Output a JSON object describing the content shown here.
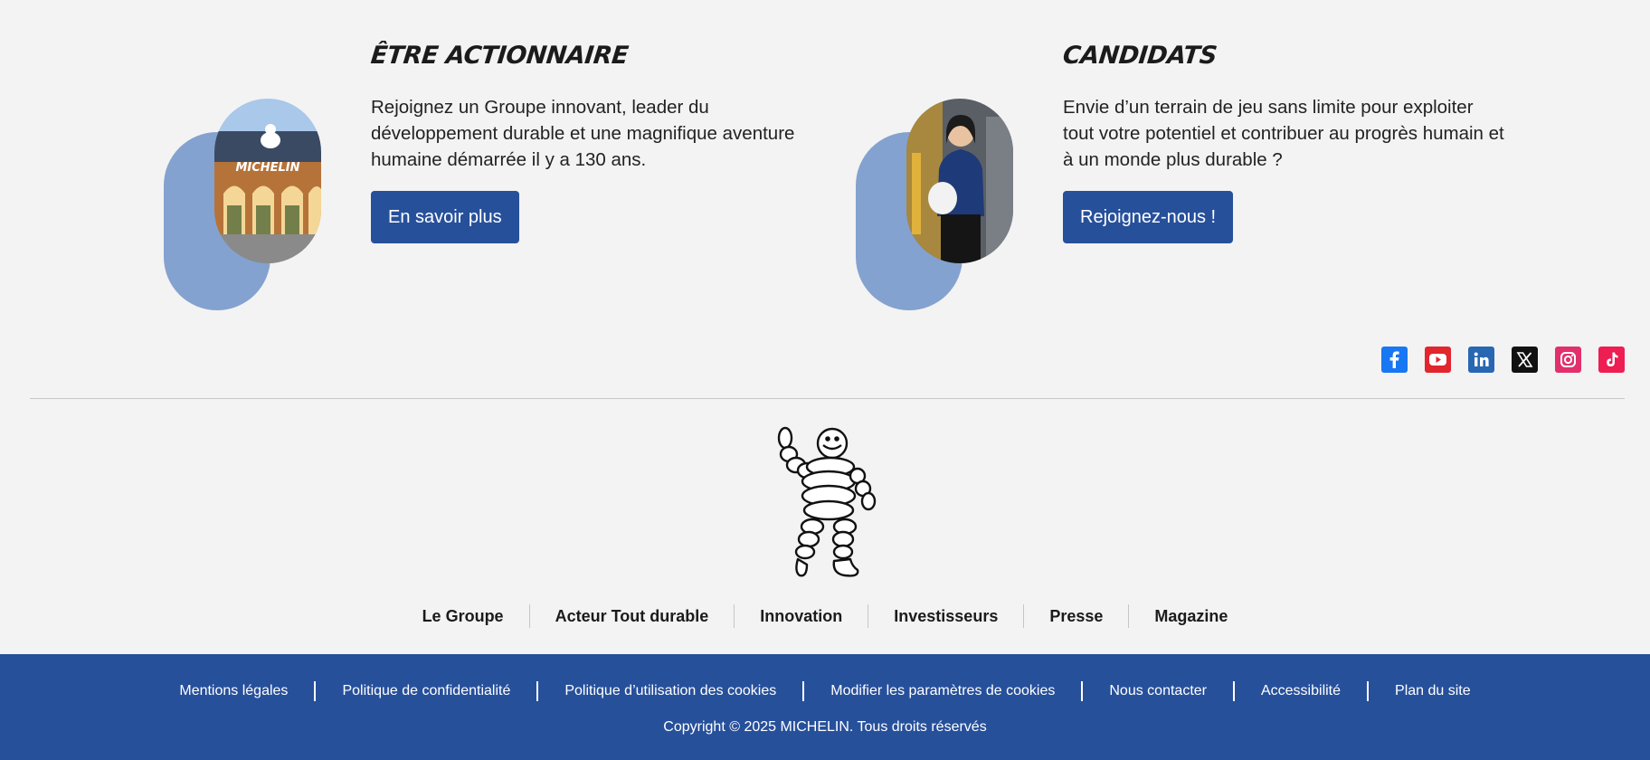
{
  "cards": [
    {
      "title": "Être actionnaire",
      "description": "Rejoignez un Groupe innovant, leader du développement durable et une magnifique aventure humaine démarrée il y a 130 ans.",
      "button_label": "En savoir plus",
      "photo_sign_text": "MICHELIN"
    },
    {
      "title": "Candidats",
      "description": "Envie d’un terrain de jeu sans limite pour exploiter tout votre potentiel et contribuer au progrès humain et à un monde plus durable ?",
      "button_label": "Rejoignez-nous !"
    }
  ],
  "social": [
    {
      "icon": "facebook-icon",
      "color": "#1877f2"
    },
    {
      "icon": "youtube-icon",
      "color": "#e1262d"
    },
    {
      "icon": "linkedin-icon",
      "color": "#2867b2"
    },
    {
      "icon": "x-icon",
      "color": "#111111"
    },
    {
      "icon": "instagram-icon",
      "color": "#e1306c"
    },
    {
      "icon": "tiktok-icon",
      "color": "#ee1d52"
    }
  ],
  "main_nav": [
    "Le Groupe",
    "Acteur Tout durable",
    "Innovation",
    "Investisseurs",
    "Presse",
    "Magazine"
  ],
  "legal_links": [
    "Mentions légales",
    "Politique de confidentialité",
    "Politique d’utilisation des cookies",
    "Modifier les paramètres de cookies",
    "Nous contacter",
    "Accessibilité",
    "Plan du site"
  ],
  "copyright": "Copyright © 2025 MICHELIN. Tous droits réservés",
  "colors": {
    "brand_blue": "#27509b",
    "blob_blue": "#84a2cf",
    "background": "#f3f3f3"
  }
}
